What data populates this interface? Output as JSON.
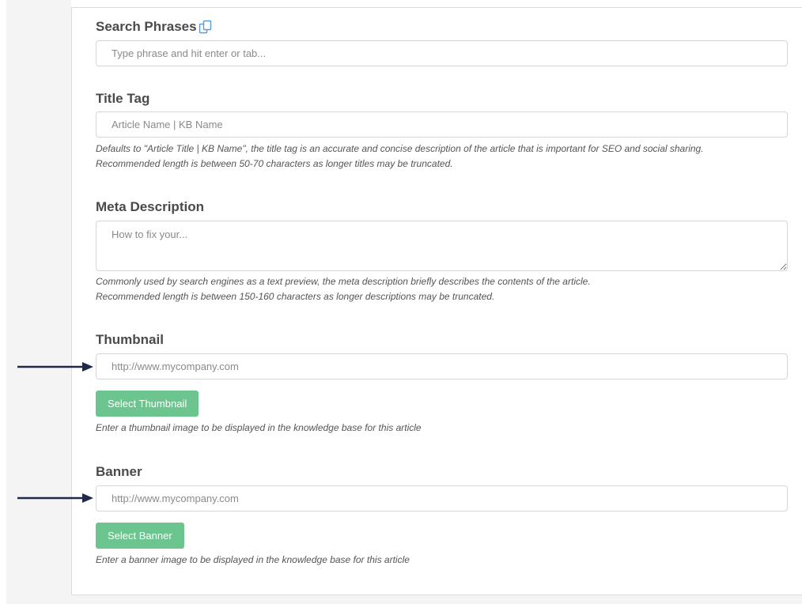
{
  "search_phrases": {
    "label": "Search Phrases",
    "icon": "copy-icon",
    "placeholder": "Type phrase and hit enter or tab..."
  },
  "title_tag": {
    "label": "Title Tag",
    "placeholder": "Article Name | KB Name",
    "help_line1": "Defaults to \"Article Title | KB Name\", the title tag is an accurate and concise description of the article that is important for SEO and social sharing.",
    "help_line2": "Recommended length is between 50-70 characters as longer titles may be truncated."
  },
  "meta_description": {
    "label": "Meta Description",
    "placeholder": "How to fix your...",
    "help_line1": "Commonly used by search engines as a text preview, the meta description briefly describes the contents of the article.",
    "help_line2": "Recommended length is between 150-160 characters as longer descriptions may be truncated."
  },
  "thumbnail": {
    "label": "Thumbnail",
    "placeholder": "http://www.mycompany.com",
    "button_label": "Select Thumbnail",
    "help": "Enter a thumbnail image to be displayed in the knowledge base for this article"
  },
  "banner": {
    "label": "Banner",
    "placeholder": "http://www.mycompany.com",
    "button_label": "Select Banner",
    "help": "Enter a banner image to be displayed in the knowledge base for this article"
  },
  "colors": {
    "button_green": "#6cc48e",
    "arrow_navy": "#1f2a4a",
    "icon_blue": "#5b9bd5"
  }
}
